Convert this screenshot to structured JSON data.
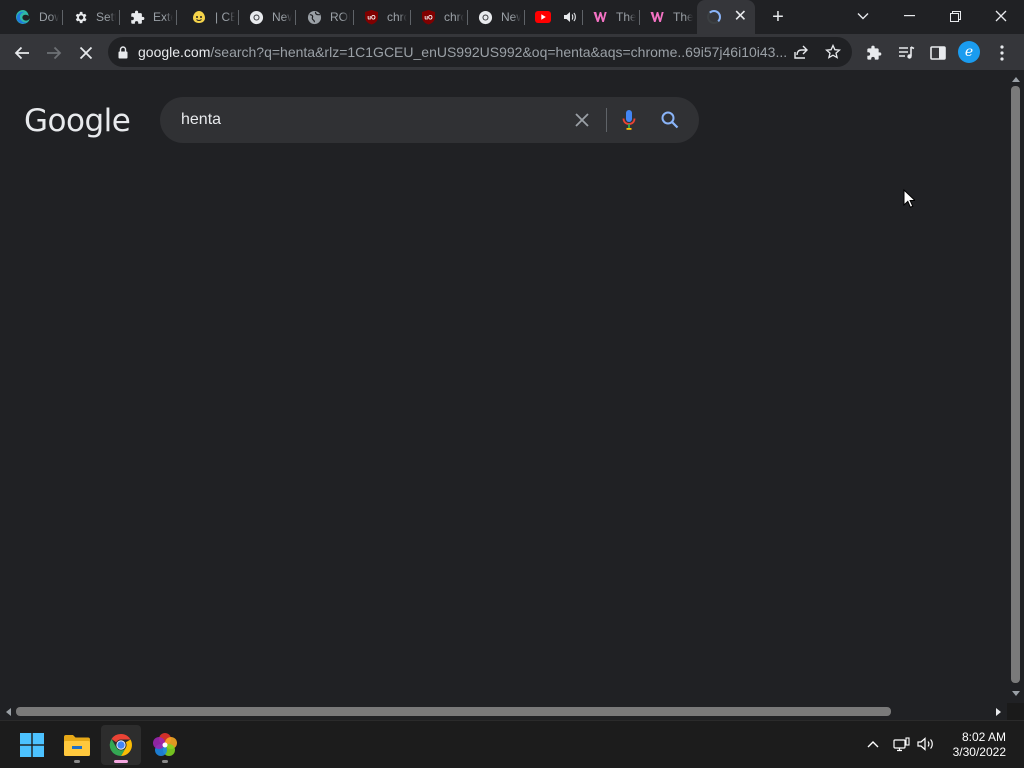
{
  "browser": {
    "tabs": [
      {
        "title": "Download",
        "icon": "edge-logo-icon"
      },
      {
        "title": "Settings",
        "icon": "gear-icon"
      },
      {
        "title": "Extensions",
        "icon": "puzzle-icon"
      },
      {
        "title": "| CE",
        "icon": "smiley-icon"
      },
      {
        "title": "New Tab",
        "icon": "chrome-icon"
      },
      {
        "title": "ROBLOX",
        "icon": "globe-icon"
      },
      {
        "title": "chrome",
        "icon": "ublock-icon"
      },
      {
        "title": "chrome",
        "icon": "ublock-icon"
      },
      {
        "title": "New Tab",
        "icon": "chrome-icon"
      },
      {
        "title": "",
        "icon": "youtube-icon",
        "audio": true
      },
      {
        "title": "The",
        "icon": "w-logo-icon"
      },
      {
        "title": "The",
        "icon": "w-logo-icon"
      },
      {
        "title": "",
        "icon": "loading-spinner-icon",
        "active": true
      }
    ],
    "new_tab_label": "+",
    "address": {
      "host": "google.com",
      "path": "/search?q=henta&rlz=1C1GCEU_enUS992US992&oq=henta&aqs=chrome..69i57j46i10i43..."
    },
    "profile_initial": "e"
  },
  "page": {
    "logo_text": "Google",
    "search_query": "henta"
  },
  "taskbar": {
    "apps": [
      "windows-start-icon",
      "file-explorer-icon",
      "chrome-icon",
      "photos-pinwheel-icon"
    ],
    "clock": {
      "time": "8:02 AM",
      "date": "3/30/2022"
    }
  },
  "colors": {
    "background": "#202124",
    "toolbar": "#35363a",
    "searchbox": "#303134",
    "accent_blue": "#8ab4f8"
  }
}
